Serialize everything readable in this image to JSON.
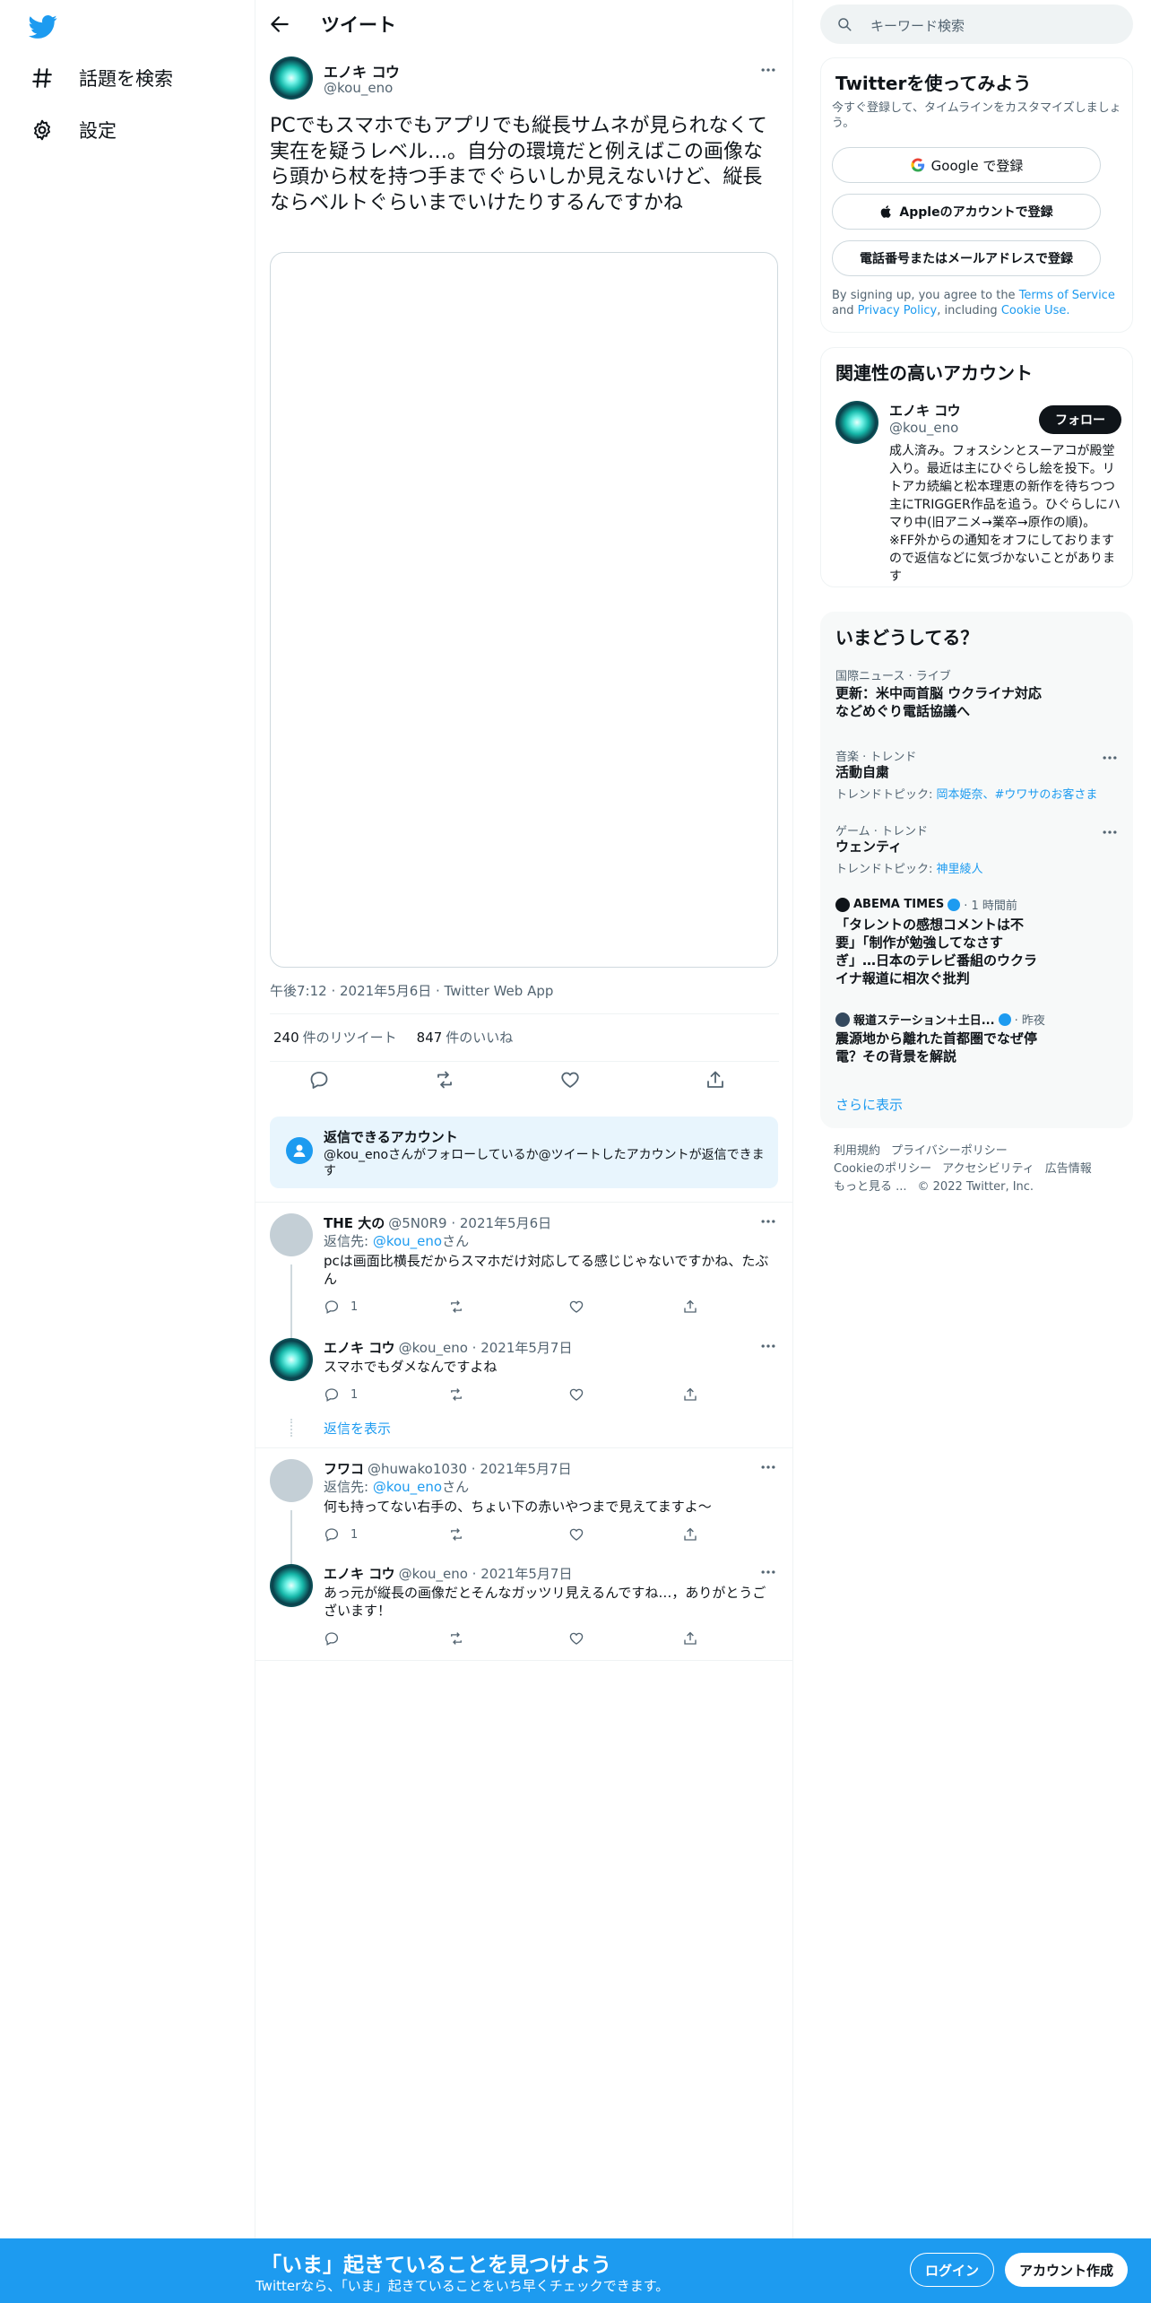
{
  "nav": {
    "logo_icon": "twitter-bird-icon",
    "items": [
      {
        "label": "話題を検索",
        "icon": "hashtag-icon"
      },
      {
        "label": "設定",
        "icon": "gear-icon"
      }
    ]
  },
  "header": {
    "title": "ツイート"
  },
  "tweet": {
    "name": "エノキ コウ",
    "handle": "@kou_eno",
    "text": "PCでもスマホでもアプリでも縦長サムネが見られなくて実在を疑うレベル…。自分の環境だと例えばこの画像なら頭から杖を持つ手までぐらいしか見えないけど、縦長ならベルトぐらいまでいけたりするんですかね",
    "meta": "午後7:12 · 2021年5月6日 · Twitter Web App",
    "retweets_count": "240",
    "retweets_label": "件のリツイート",
    "likes_count": "847",
    "likes_label": "件のいいね"
  },
  "reply_restriction": {
    "title": "返信できるアカウント",
    "desc": "@kou_enoさんがフォローしているか@ツイートしたアカウントが返信できます"
  },
  "replies": [
    {
      "name": "THE 大の",
      "handle": "@5N0R9",
      "date": "· 2021年5月6日",
      "reply_to_label": "返信先:",
      "reply_to_handle": "@kou_eno",
      "reply_to_suffix": "さん",
      "text1": "pcは画面比横長だからスマホだけ対応してる感じじゃないですかね、たぶ",
      "text2": "ん",
      "reply_count": "1"
    },
    {
      "name": "エノキ コウ",
      "handle": "@kou_eno",
      "date": "· 2021年5月7日",
      "text1": "スマホでもダメなんですよね",
      "reply_count": "1",
      "show_replies": "返信を表示"
    },
    {
      "name": "フワコ",
      "handle": "@huwako1030",
      "date": "· 2021年5月7日",
      "reply_to_label": "返信先:",
      "reply_to_handle": "@kou_eno",
      "reply_to_suffix": "さん",
      "text1": "何も持ってない右手の、ちょい下の赤いやつまで見えてますよ～",
      "reply_count": "1"
    },
    {
      "name": "エノキ コウ",
      "handle": "@kou_eno",
      "date": "· 2021年5月7日",
      "text1": "あっ元が縦長の画像だとそんなガッツリ見えるんですね…，ありがとうご",
      "text2": "ざいます！",
      "reply_count": ""
    }
  ],
  "search": {
    "placeholder": "キーワード検索"
  },
  "signup_card": {
    "title": "Twitterを使ってみよう",
    "subtitle": "今すぐ登録して、タイムラインをカスタマイズしましょう。",
    "google": "Google で登録",
    "apple": "Appleのアカウントで登録",
    "phone": "電話番号またはメールアドレスで登録",
    "legal_1": "By signing up, you agree to the",
    "tos": "Terms of Service",
    "and": "and",
    "privacy": "Privacy Policy",
    "including": ", including",
    "cookie": "Cookie Use."
  },
  "related": {
    "title": "関連性の高いアカウント",
    "name": "エノキ コウ",
    "handle": "@kou_eno",
    "follow": "フォロー",
    "bio": "成人済み。フォスシンとスーアコが殿堂入り。最近は主にひぐらし絵を投下。リトアカ続編と松本理恵の新作を待ちつつ主にTRIGGER作品を追う。ひぐらしにハマり中(旧アニメ→業卒→原作の順)。 ※FF外からの通知をオフにしておりますので返信などに気づかないことがあります"
  },
  "trends": {
    "title": "いまどうしてる？",
    "items": [
      {
        "cat": "国際ニュース · ライブ",
        "title1": "更新：米中両首脳 ウクライナ対応",
        "title2": "などめぐり電話協議へ"
      },
      {
        "cat": "音楽 · トレンド",
        "title1": "活動自粛",
        "sub_label": "トレンドトピック:",
        "sub_links": "岡本姫奈、#ウワサのお客さま"
      },
      {
        "cat": "ゲーム · トレンド",
        "title1": "ウェンティ",
        "sub_label": "トレンドトピック:",
        "sub_links": "神里綾人"
      },
      {
        "source": "ABEMA TIMES",
        "time": "· 1 時間前",
        "title1": "「タレントの感想コメントは不",
        "title2": "要」「制作が勉強してなさす",
        "title3": "ぎ」…日本のテレビ番組のウクラ",
        "title4": "イナ報道に相次ぐ批判"
      },
      {
        "source": "報道ステーション＋土日...",
        "time": "· 昨夜",
        "title1": "震源地から離れた首都圏でなぜ停",
        "title2": "電？その背景を解説"
      }
    ],
    "show_more": "さらに表示"
  },
  "footer": {
    "terms": "利用規約",
    "privacy": "プライバシーポリシー",
    "cookie": "Cookieのポリシー",
    "accessibility": "アクセシビリティ",
    "ads": "広告情報",
    "more": "もっと見る ...",
    "copyright": "© 2022 Twitter, Inc."
  },
  "bottom_bar": {
    "title": "「いま」起きていることを見つけよう",
    "subtitle": "Twitterなら、「いま」起きていることをいち早くチェックできます。",
    "login": "ログイン",
    "signup": "アカウント作成"
  },
  "colors": {
    "accent": "#1d9bf0",
    "text": "#0f1419",
    "muted": "#536471"
  }
}
